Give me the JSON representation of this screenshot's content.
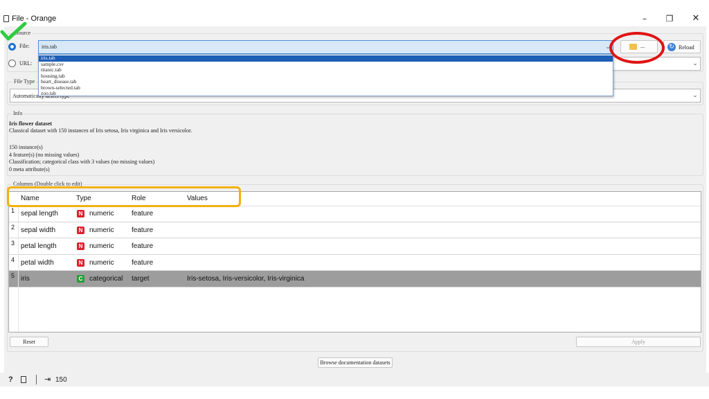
{
  "window": {
    "title": "File - Orange"
  },
  "source": {
    "legend": "Source",
    "file_label": "File:",
    "file_value": "iris.tab",
    "url_label": "URL:",
    "browse_label": "...",
    "reload_label": "Reload",
    "file_options": [
      "iris.tab",
      "sample.csv",
      "titanic.tab",
      "housing.tab",
      "heart_disease.tab",
      "brown-selected.tab",
      "zoo.tab"
    ]
  },
  "file_type": {
    "legend": "File Type",
    "value": "Automatically detect type"
  },
  "info": {
    "legend": "Info",
    "title": "Iris flower dataset",
    "description": "Classical dataset with 150 instances of Iris setosa, Iris virginica and Iris versicolor.",
    "lines": [
      "150 instance(s)",
      "4 feature(s) (no missing values)",
      "Classification; categorical class with 3 values (no missing values)",
      "0 meta attribute(s)"
    ]
  },
  "columns": {
    "legend": "Columns (Double click to edit)",
    "headers": [
      "Name",
      "Type",
      "Role",
      "Values"
    ],
    "rows": [
      {
        "num": "1",
        "name": "sepal length",
        "badge": "N",
        "type": "numeric",
        "role": "feature",
        "values": ""
      },
      {
        "num": "2",
        "name": "sepal width",
        "badge": "N",
        "type": "numeric",
        "role": "feature",
        "values": ""
      },
      {
        "num": "3",
        "name": "petal length",
        "badge": "N",
        "type": "numeric",
        "role": "feature",
        "values": ""
      },
      {
        "num": "4",
        "name": "petal width",
        "badge": "N",
        "type": "numeric",
        "role": "feature",
        "values": ""
      },
      {
        "num": "5",
        "name": "iris",
        "badge": "C",
        "type": "categorical",
        "role": "target",
        "values": "Iris-setosa, Iris-versicolor, Iris-virginica"
      }
    ]
  },
  "buttons": {
    "reset": "Reset",
    "apply": "Apply",
    "browse_docs": "Browse documentation datasets"
  },
  "status": {
    "count": "150"
  },
  "colors": {
    "numeric_badge": "#d9232d",
    "categorical_badge": "#2a9d3a",
    "annotation_red": "#e01313",
    "annotation_yellow": "#f4b10c",
    "check_green": "#2ecc40",
    "accent_blue": "#1f6fd1"
  },
  "icons": {
    "window_doc": "document-icon",
    "browse": "folder-icon",
    "reload": "reload-icon",
    "help": "help-icon",
    "report": "report-icon",
    "output": "output-icon",
    "annotation_check": "checkmark-icon"
  }
}
